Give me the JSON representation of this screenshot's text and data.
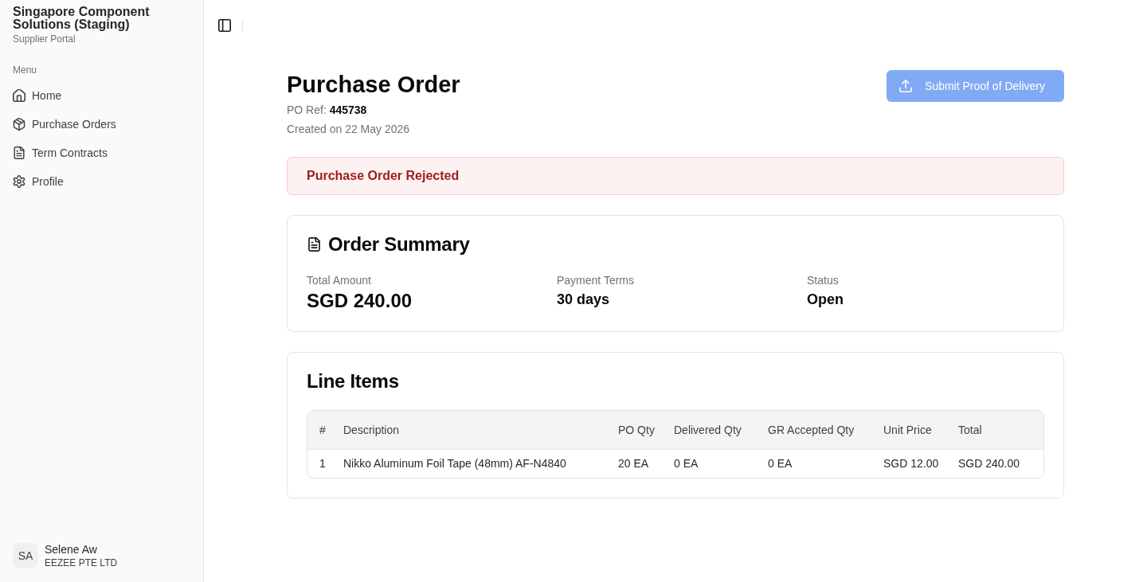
{
  "sidebar": {
    "title": "Singapore Component Solutions (Staging)",
    "subtitle": "Supplier Portal",
    "menu_label": "Menu",
    "items": [
      {
        "label": "Home",
        "selected": false
      },
      {
        "label": "Purchase Orders",
        "selected": false
      },
      {
        "label": "Term Contracts",
        "selected": false
      },
      {
        "label": "Profile",
        "selected": false
      }
    ],
    "user": {
      "initials": "SA",
      "name": "Selene Aw",
      "company": "EEZEE PTE LTD"
    }
  },
  "header": {
    "title": "Purchase Order",
    "po_ref": "PO Ref: **445738**",
    "created": "Created on 22 May 2026",
    "action": {
      "label": "Submit Proof of Delivery",
      "disabled": true
    }
  },
  "alert": {
    "kind": "error",
    "text": "Purchase Order Rejected"
  },
  "order_summary": {
    "title": "Order Summary",
    "fields": [
      {
        "label": "Total Amount",
        "value": "SGD 240.00",
        "kind": "amount"
      },
      {
        "label": "Payment Terms",
        "value": "30 days",
        "kind": "text"
      },
      {
        "label": "Status",
        "value": "Open",
        "kind": "text"
      }
    ]
  },
  "line_items": {
    "title": "Line Items",
    "columns": [
      "#",
      "Description",
      "PO Qty",
      "Delivered Qty",
      "GR Accepted Qty",
      "Unit Price",
      "Total"
    ],
    "rows": [
      [
        "1",
        "Nikko Aluminum Foil Tape (48mm) AF-N4840",
        "20 EA",
        "0 EA",
        "0 EA",
        "SGD 12.00",
        "SGD 240.00"
      ]
    ]
  }
}
